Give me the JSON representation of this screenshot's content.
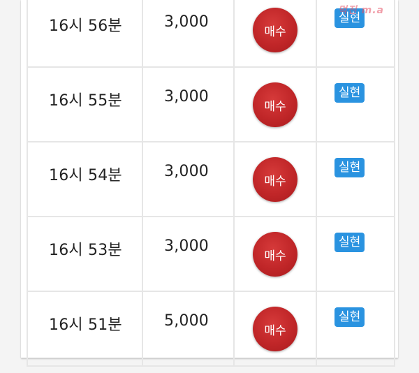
{
  "watermark": "먹진 m.a",
  "rows": [
    {
      "time": "16시 56분",
      "amount": "3,000",
      "action": "매수",
      "status": "실현"
    },
    {
      "time": "16시 55분",
      "amount": "3,000",
      "action": "매수",
      "status": "실현"
    },
    {
      "time": "16시 54분",
      "amount": "3,000",
      "action": "매수",
      "status": "실현"
    },
    {
      "time": "16시 53분",
      "amount": "3,000",
      "action": "매수",
      "status": "실현"
    },
    {
      "time": "16시 51분",
      "amount": "5,000",
      "action": "매수",
      "status": "실현"
    }
  ]
}
